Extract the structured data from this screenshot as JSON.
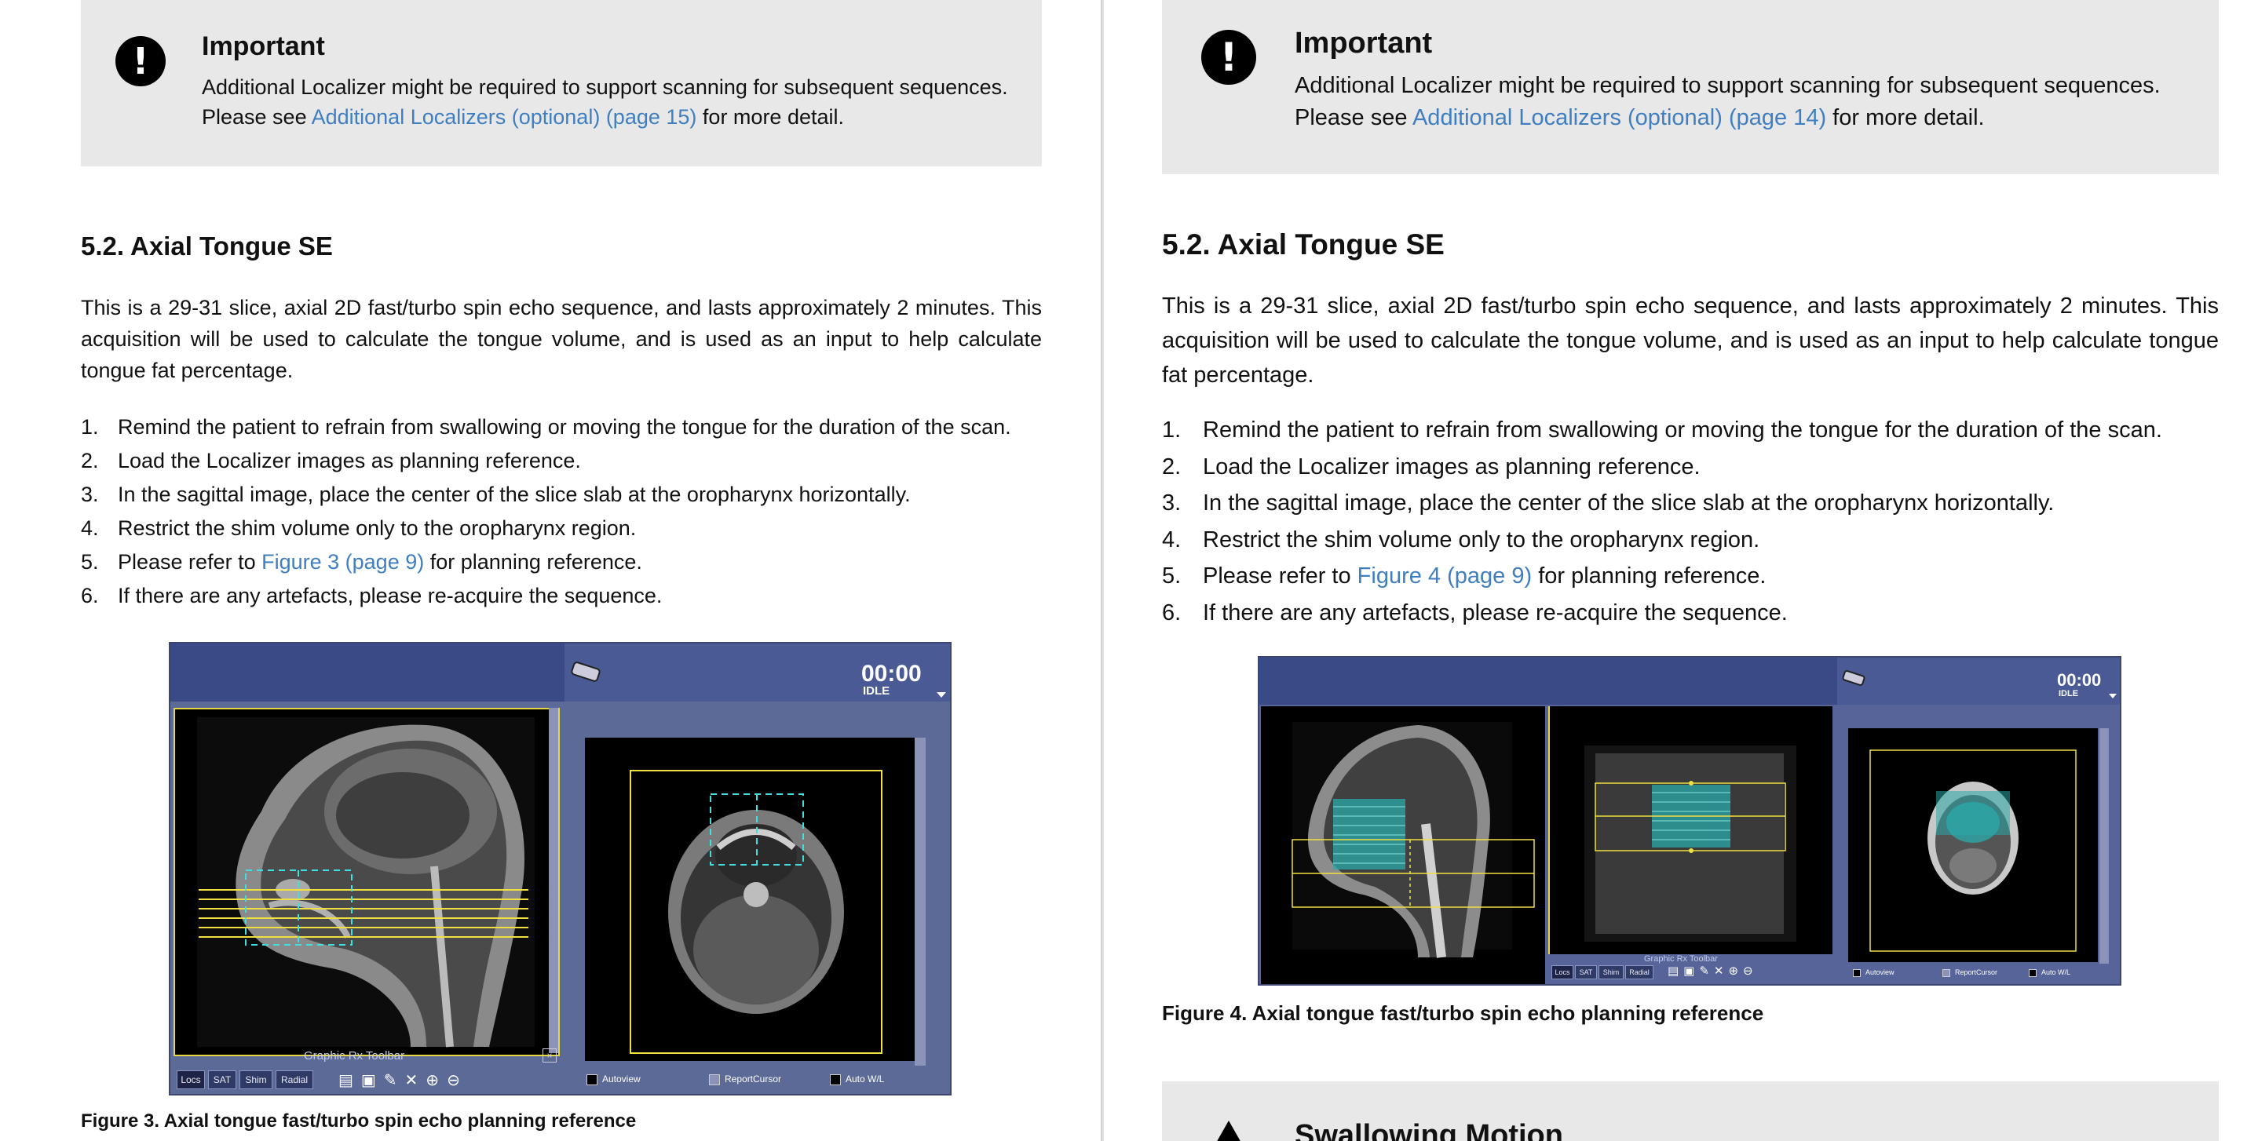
{
  "left": {
    "important": {
      "title": "Important",
      "line1": "Additional Localizer might be required to support scanning for subsequent sequences.",
      "line2_prefix": "Please see",
      "line2_link": "Additional Localizers (optional) (page 15)",
      "line2_suffix": "for more detail."
    },
    "heading": "5.2. Axial Tongue SE",
    "paragraph": "This is a 29-31 slice, axial 2D fast/turbo spin echo sequence, and lasts approximately 2 minutes. This acquisition will be used to calculate the tongue volume, and is used as an input to help calculate tongue fat percentage.",
    "steps": [
      {
        "num": "1.",
        "text": "Remind the patient to refrain from swallowing or moving the tongue for the duration of the scan."
      },
      {
        "num": "2.",
        "text": "Load the Localizer images as planning reference."
      },
      {
        "num": "3.",
        "text": "In the sagittal image, place the center of the slice slab at the oropharynx horizontally."
      },
      {
        "num": "4.",
        "text": "Restrict the shim volume only to the oropharynx region."
      },
      {
        "num": "5.",
        "prefix": "Please refer to",
        "link": "Figure 3 (page 9)",
        "suffix": "for planning reference."
      },
      {
        "num": "6.",
        "text": "If there are any artefacts, please re-acquire the sequence."
      }
    ],
    "figure": {
      "timer": "00:00",
      "status": "IDLE",
      "toolbar_title": "Graphic Rx Toolbar",
      "tabs": [
        "Locs",
        "SAT",
        "Shim",
        "Radial"
      ],
      "checkboxes": [
        "Autoview",
        "ReportCursor",
        "Auto W/L"
      ]
    },
    "caption": "Figure 3. Axial tongue fast/turbo spin echo planning reference"
  },
  "right": {
    "important": {
      "title": "Important",
      "line1": "Additional Localizer might be required to support scanning for subsequent sequences.",
      "line2_prefix": "Please see",
      "line2_link": "Additional Localizers (optional) (page 14)",
      "line2_suffix": "for more detail."
    },
    "heading": "5.2. Axial Tongue SE",
    "paragraph": "This is a 29-31 slice, axial 2D fast/turbo spin echo sequence, and lasts approximately 2 minutes. This acquisition will be used to calculate the tongue volume, and is used as an input to help calculate tongue fat percentage.",
    "steps": [
      {
        "num": "1.",
        "text": "Remind the patient to refrain from swallowing or moving the tongue for the duration of the scan."
      },
      {
        "num": "2.",
        "text": "Load the Localizer images as planning reference."
      },
      {
        "num": "3.",
        "text": "In the sagittal image, place the center of the slice slab at the oropharynx horizontally."
      },
      {
        "num": "4.",
        "text": "Restrict the shim volume only to the oropharynx region."
      },
      {
        "num": "5.",
        "prefix": "Please refer to",
        "link": "Figure 4 (page 9)",
        "suffix": "for planning reference."
      },
      {
        "num": "6.",
        "text": "If there are any artefacts, please re-acquire the sequence."
      }
    ],
    "figure": {
      "timer": "00:00",
      "status": "IDLE",
      "toolbar_title": "Graphic Rx Toolbar",
      "tabs": [
        "Locs",
        "SAT",
        "Shim",
        "Radial"
      ],
      "checkboxes": [
        "Autoview",
        "ReportCursor",
        "Auto W/L"
      ]
    },
    "caption": "Figure 4. Axial tongue fast/turbo spin echo planning reference",
    "next_callout_title": "Swallowing Motion"
  },
  "colors": {
    "link": "#3f7fc1",
    "callout_bg": "#e8e8e8",
    "mri_frame": "#5c6a98",
    "slice_lines": "#f0e040",
    "shim_box": "#40e0e0"
  }
}
